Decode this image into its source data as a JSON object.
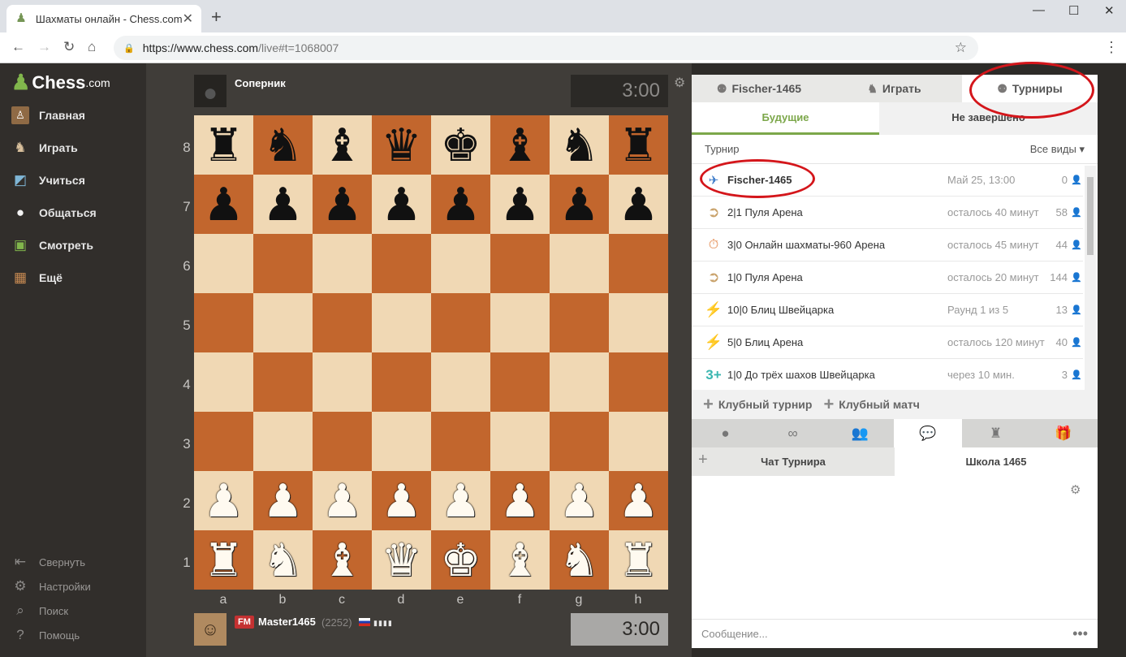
{
  "browser": {
    "tab_title": "Шахматы онлайн - Chess.com",
    "url_base": "https://www.chess.com",
    "url_path": "/live#t=1068007",
    "colors": {
      "accent": "#81b64c",
      "annotation": "#d4161b"
    }
  },
  "sidebar": {
    "logo_text": "Chess",
    "logo_suffix": ".com",
    "items": [
      {
        "label": "Главная",
        "icon": "home-icon"
      },
      {
        "label": "Играть",
        "icon": "play-icon"
      },
      {
        "label": "Учиться",
        "icon": "learn-icon"
      },
      {
        "label": "Общаться",
        "icon": "social-icon"
      },
      {
        "label": "Смотреть",
        "icon": "watch-icon"
      },
      {
        "label": "Ещё",
        "icon": "more-icon"
      }
    ],
    "bottom_items": [
      {
        "label": "Свернуть",
        "icon": "collapse-icon"
      },
      {
        "label": "Настройки",
        "icon": "settings-icon"
      },
      {
        "label": "Поиск",
        "icon": "search-icon"
      },
      {
        "label": "Помощь",
        "icon": "help-icon"
      }
    ]
  },
  "game": {
    "opponent": {
      "name": "Соперник",
      "clock": "3:00"
    },
    "player": {
      "title": "FM",
      "name": "Master1465",
      "rating": "(2252)",
      "clock": "3:00"
    },
    "ranks": [
      "8",
      "7",
      "6",
      "5",
      "4",
      "3",
      "2",
      "1"
    ],
    "files": [
      "a",
      "b",
      "c",
      "d",
      "e",
      "f",
      "g",
      "h"
    ],
    "board": [
      [
        "br",
        "bn",
        "bb",
        "bq",
        "bk",
        "bb",
        "bn",
        "br"
      ],
      [
        "bp",
        "bp",
        "bp",
        "bp",
        "bp",
        "bp",
        "bp",
        "bp"
      ],
      [
        "",
        "",
        "",
        "",
        "",
        "",
        "",
        ""
      ],
      [
        "",
        "",
        "",
        "",
        "",
        "",
        "",
        ""
      ],
      [
        "",
        "",
        "",
        "",
        "",
        "",
        "",
        ""
      ],
      [
        "",
        "",
        "",
        "",
        "",
        "",
        "",
        ""
      ],
      [
        "wp",
        "wp",
        "wp",
        "wp",
        "wp",
        "wp",
        "wp",
        "wp"
      ],
      [
        "wr",
        "wn",
        "wb",
        "wq",
        "wk",
        "wb",
        "wn",
        "wr"
      ]
    ]
  },
  "panel": {
    "tabs": [
      {
        "label": "Fischer-1465",
        "icon": "club-icon"
      },
      {
        "label": "Играть",
        "icon": "play-icon"
      },
      {
        "label": "Турниры",
        "icon": "tournament-icon"
      }
    ],
    "subtabs": [
      {
        "label": "Будущие"
      },
      {
        "label": "Не завершено"
      }
    ],
    "list_header": {
      "left": "Турнир",
      "right": "Все виды"
    },
    "tournaments": [
      {
        "name": "Fischer-1465",
        "time": "Май 25, 13:00",
        "count": "0",
        "icon": "club-logo-icon",
        "icon_color": "#3d7cc9"
      },
      {
        "name": "2|1 Пуля Арена",
        "time": "осталось 40 минут",
        "count": "58",
        "icon": "bullet-icon",
        "icon_color": "#c9a26b"
      },
      {
        "name": "3|0 Онлайн шахматы-960 Арена",
        "time": "осталось 45 минут",
        "count": "44",
        "icon": "chess960-icon",
        "icon_color": "#e07b39"
      },
      {
        "name": "1|0 Пуля Арена",
        "time": "осталось 20 минут",
        "count": "144",
        "icon": "bullet-icon",
        "icon_color": "#c9a26b"
      },
      {
        "name": "10|0 Блиц Швейцарка",
        "time": "Раунд 1 из 5",
        "count": "13",
        "icon": "blitz-icon",
        "icon_color": "#f2c21b"
      },
      {
        "name": "5|0 Блиц Арена",
        "time": "осталось 120 минут",
        "count": "40",
        "icon": "blitz-icon",
        "icon_color": "#f2c21b"
      },
      {
        "name": "1|0 До трёх шахов Швейцарка",
        "time": "через 10 мин.",
        "count": "3",
        "icon": "three-check-icon",
        "icon_color": "#3ab6b0"
      }
    ],
    "actions": [
      {
        "label": "Клубный турнир"
      },
      {
        "label": "Клубный матч"
      }
    ],
    "chat": {
      "tab_icons": [
        "chat-bubble-icon",
        "binoculars-icon",
        "friends-icon",
        "chat-icon",
        "leaderboard-icon",
        "gift-icon"
      ],
      "room_a": "Чат Турнира",
      "room_b": "Школа 1465",
      "message_placeholder": "Сообщение..."
    }
  }
}
